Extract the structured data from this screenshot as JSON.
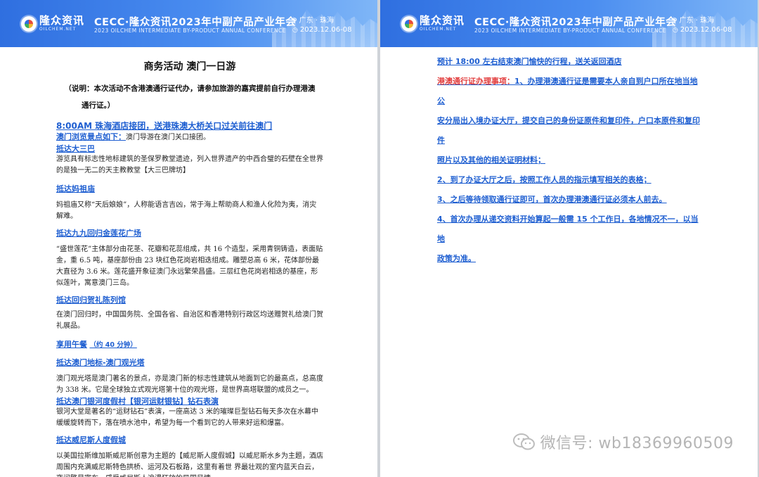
{
  "header": {
    "logo_cn": "隆众资讯",
    "logo_en": "OILCHEM.NET",
    "title": "CECC·隆众资讯2023年中副产品产业年会",
    "subtitle": "2023 OILCHEM INTERMEDIATE BY-PRODUCT ANNUAL CONFERENCE",
    "location": "广东 · 珠海",
    "date": "2023.12.06-08"
  },
  "left": {
    "title": "商务活动    澳门一日游",
    "note_line1": "（说明：本次活动不含港澳通行证代办，请参加旅游的嘉宾提前自行办理港澳",
    "note_line2": "通行证。）",
    "intro_heading": "8:00AM  珠海酒店接团，送港珠澳大桥关口过关前往澳门",
    "itinerary_label": "澳门浏览景点如下：",
    "itinerary_text": "澳门导游在澳门关口接团。",
    "sections": [
      {
        "heading": "抵达大三巴",
        "body": "游览具有标志性地标建筑的圣保罗教堂遗迹，列入世界遗产的中西合璧的石壁在全世界的是独一无二的天主教教堂【大三巴牌坊】"
      },
      {
        "heading": "抵达妈祖庙",
        "body": "妈祖庙又称“天后娘娘”，人称能语言吉凶，常于海上帮助商人和渔人化险为夷，消灾解难。"
      },
      {
        "heading": "抵达九九回归金莲花广场",
        "body": "“盛世莲花”主体部分由花茎、花瓣和花蕊组成，共 16 个造型，采用青铜铸造，表面贴金，重 6.5 吨，基座部份由 23 块红色花岗岩相迭组成。雕塑总高 6 米，花体部份最大直径为 3.6 米。莲花盛开象征澳门永远繁荣昌盛。三层红色花岗岩相迭的基座，形似莲叶，寓意澳门三岛。"
      },
      {
        "heading": "抵达回归贺礼陈列馆",
        "body": "在澳门回归时，中国国务院、全国各省、自治区和香港特别行政区均送赠贺礼给澳门贺礼展品。"
      },
      {
        "heading": "享用午餐",
        "heading_extra": "（约 40 分钟）",
        "body": ""
      },
      {
        "heading": "抵达澳门地标-澳门观光塔",
        "body": "澳门观光塔是澳门著名的景点，亦是澳门新的标志性建筑从地面到它的最高点，总高度为 338 米。它是全球独立式观光塔第十位的观光塔，是世界高塔联盟的成员之一。"
      },
      {
        "heading": "抵达澳门银河度假村【银河运财银钻】钻石表演",
        "body": "银河大堂是著名的“运财钻石”表演，一座高达 3 米的璀璨巨型钻石每天多次在水幕中缓缓旋转而下，落在喷水池中，希望为每一个看到它的人带来好运和爆富。"
      },
      {
        "heading": "抵达威尼斯人度假城",
        "body": "以美国拉斯维加斯威尼斯创意为主题的【威尼斯人度假城】以威尼斯水乡为主题，酒店周围内充满威尼斯特色拱桥、运河及石板路，这里有着世 界最壮观的室内蓝天白云，夜间繁星密布，感受威尼斯人浪漫狂放的异国风情。"
      }
    ]
  },
  "right": {
    "line0": "预计 18:00 左右结束澳门愉快的行程，送关返回酒店",
    "permit_label": "港澳通行证办理事项：",
    "lines": [
      "1、办理港澳通行证是需要本人亲自到户口所在地当地公",
      "安分局出入境办证大厅，提交自己的身份证原件和复印件，户口本原件和复印件",
      "照片以及其他的相关证明材料；",
      "2、到了办证大厅之后，按照工作人员的指示填写相关的表格；",
      "3、之后等待领取通行证即可，首次办理港澳通行证必须本人前去。",
      "4、首次办理从递交资料开始算起一般需 15 个工作日，各地情况不一，以当地",
      "政策为准。"
    ]
  },
  "watermark": "微信号: wb18369960509"
}
